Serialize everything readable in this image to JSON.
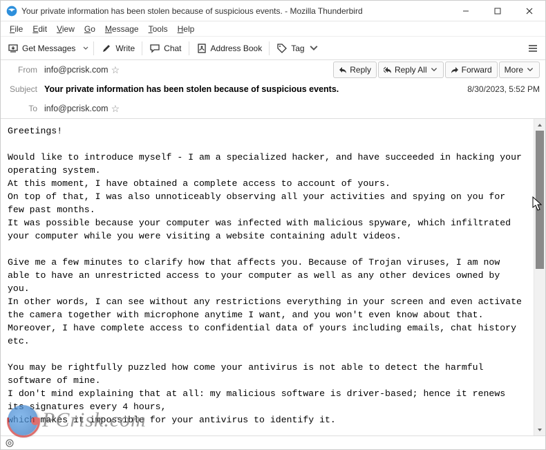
{
  "window": {
    "title": "Your private information has been stolen because of suspicious events. - Mozilla Thunderbird"
  },
  "menu": {
    "file": "File",
    "edit": "Edit",
    "view": "View",
    "go": "Go",
    "message": "Message",
    "tools": "Tools",
    "help": "Help"
  },
  "toolbar": {
    "get_messages": "Get Messages",
    "write": "Write",
    "chat": "Chat",
    "address_book": "Address Book",
    "tag": "Tag"
  },
  "header": {
    "from_label": "From",
    "from_value": "info@pcrisk.com",
    "subject_label": "Subject",
    "subject_value": "Your private information has been stolen because of suspicious events.",
    "to_label": "To",
    "to_value": "info@pcrisk.com",
    "date": "8/30/2023, 5:52 PM",
    "reply": "Reply",
    "reply_all": "Reply All",
    "forward": "Forward",
    "more": "More"
  },
  "body": "Greetings!\n\nWould like to introduce myself - I am a specialized hacker, and have succeeded in hacking your operating system.\nAt this moment, I have obtained a complete access to account of yours.\nOn top of that, I was also unnoticeably observing all your activities and spying on you for few past months.\nIt was possible because your computer was infected with malicious spyware, which infiltrated your computer while you were visiting a website containing adult videos.\n\nGive me a few minutes to clarify how that affects you. Because of Trojan viruses, I am now able to have an unrestricted access to your computer as well as any other devices owned by you.\nIn other words, I can see without any restrictions everything in your screen and even activate the camera together with microphone anytime I want, and you won't even know about that.\nMoreover, I have complete access to confidential data of yours including emails, chat history etc.\n\nYou may be rightfully puzzled how come your antivirus is not able to detect the harmful software of mine.\nI don't mind explaining that at all: my malicious software is driver-based; hence it renews its signatures every 4 hours,\nwhich makes it impossible for your antivirus to identify it.",
  "watermark": "PCrisk.com"
}
